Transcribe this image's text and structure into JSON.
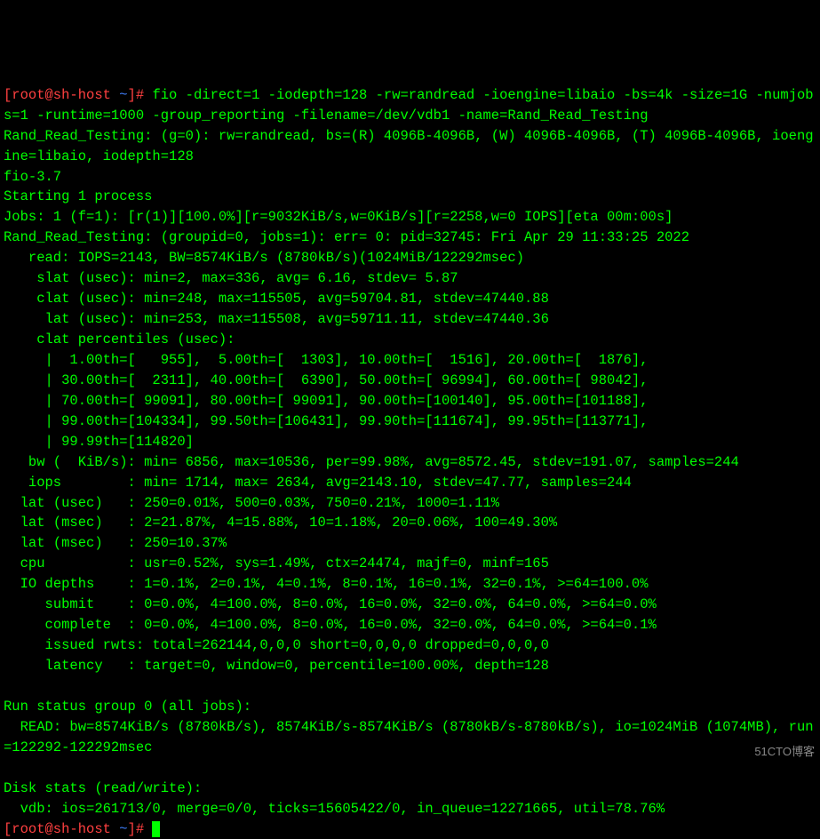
{
  "prompt": {
    "user_host": "[root@sh-host ",
    "path": "~",
    "close": "]# "
  },
  "command": "fio -direct=1 -iodepth=128 -rw=randread -ioengine=libaio -bs=4k -size=1G -numjobs=1 -runtime=1000 -group_reporting -filename=/dev/vdb1 -name=Rand_Read_Testing",
  "out": {
    "l1": "Rand_Read_Testing: (g=0): rw=randread, bs=(R) 4096B-4096B, (W) 4096B-4096B, (T) 4096B-4096B, ioengine=libaio, iodepth=128",
    "l2": "fio-3.7",
    "l3": "Starting 1 process",
    "l4": "Jobs: 1 (f=1): [r(1)][100.0%][r=9032KiB/s,w=0KiB/s][r=2258,w=0 IOPS][eta 00m:00s]",
    "l5": "Rand_Read_Testing: (groupid=0, jobs=1): err= 0: pid=32745: Fri Apr 29 11:33:25 2022",
    "l6": "   read: IOPS=2143, BW=8574KiB/s (8780kB/s)(1024MiB/122292msec)",
    "l7": "    slat (usec): min=2, max=336, avg= 6.16, stdev= 5.87",
    "l8": "    clat (usec): min=248, max=115505, avg=59704.81, stdev=47440.88",
    "l9": "     lat (usec): min=253, max=115508, avg=59711.11, stdev=47440.36",
    "l10": "    clat percentiles (usec):",
    "l11": "     |  1.00th=[   955],  5.00th=[  1303], 10.00th=[  1516], 20.00th=[  1876],",
    "l12": "     | 30.00th=[  2311], 40.00th=[  6390], 50.00th=[ 96994], 60.00th=[ 98042],",
    "l13": "     | 70.00th=[ 99091], 80.00th=[ 99091], 90.00th=[100140], 95.00th=[101188],",
    "l14": "     | 99.00th=[104334], 99.50th=[106431], 99.90th=[111674], 99.95th=[113771],",
    "l15": "     | 99.99th=[114820]",
    "l16": "   bw (  KiB/s): min= 6856, max=10536, per=99.98%, avg=8572.45, stdev=191.07, samples=244",
    "l17": "   iops        : min= 1714, max= 2634, avg=2143.10, stdev=47.77, samples=244",
    "l18": "  lat (usec)   : 250=0.01%, 500=0.03%, 750=0.21%, 1000=1.11%",
    "l19": "  lat (msec)   : 2=21.87%, 4=15.88%, 10=1.18%, 20=0.06%, 100=49.30%",
    "l20": "  lat (msec)   : 250=10.37%",
    "l21": "  cpu          : usr=0.52%, sys=1.49%, ctx=24474, majf=0, minf=165",
    "l22": "  IO depths    : 1=0.1%, 2=0.1%, 4=0.1%, 8=0.1%, 16=0.1%, 32=0.1%, >=64=100.0%",
    "l23": "     submit    : 0=0.0%, 4=100.0%, 8=0.0%, 16=0.0%, 32=0.0%, 64=0.0%, >=64=0.0%",
    "l24": "     complete  : 0=0.0%, 4=100.0%, 8=0.0%, 16=0.0%, 32=0.0%, 64=0.0%, >=64=0.1%",
    "l25": "     issued rwts: total=262144,0,0,0 short=0,0,0,0 dropped=0,0,0,0",
    "l26": "     latency   : target=0, window=0, percentile=100.00%, depth=128",
    "l27": "",
    "l28": "Run status group 0 (all jobs):",
    "l29": "  READ: bw=8574KiB/s (8780kB/s), 8574KiB/s-8574KiB/s (8780kB/s-8780kB/s), io=1024MiB (1074MB), run=122292-122292msec",
    "l30": "",
    "l31": "Disk stats (read/write):",
    "l32": "  vdb: ios=261713/0, merge=0/0, ticks=15605422/0, in_queue=12271665, util=78.76%"
  },
  "watermark": "51CTO博客"
}
